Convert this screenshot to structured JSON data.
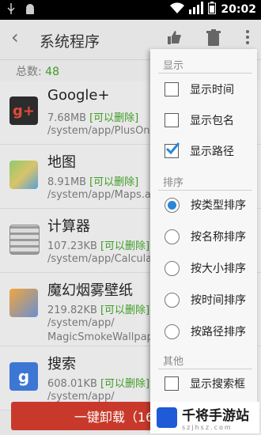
{
  "status": {
    "time": "20:02"
  },
  "toolbar": {
    "title": "系统程序"
  },
  "summary": {
    "label": "总数:",
    "count": "48"
  },
  "apps": [
    {
      "name": "Google+",
      "size": "7.68MB",
      "tag": "[可以删除]",
      "path": "/system/app/PlusOn"
    },
    {
      "name": "地图",
      "size": "8.91MB",
      "tag": "[可以删除]",
      "path": "/system/app/Maps.a"
    },
    {
      "name": "计算器",
      "size": "107.23KB",
      "tag": "[可以删除]",
      "path": "/system/app/Calcula"
    },
    {
      "name": "魔幻烟雾壁纸",
      "size": "219.82KB",
      "tag": "[可以删除]",
      "path": "/system/app/",
      "path2": "MagicSmokeWallpap"
    },
    {
      "name": "搜索",
      "size": "608.01KB",
      "tag": "[可以删除]",
      "path": "/system/app/"
    }
  ],
  "uninstall": {
    "label": "一键卸载（16"
  },
  "menu": {
    "display_header": "显示",
    "show_time": "显示时间",
    "show_package": "显示包名",
    "show_path": "显示路径",
    "sort_header": "排序",
    "sort_type": "按类型排序",
    "sort_name": "按名称排序",
    "sort_size": "按大小排序",
    "sort_time": "按时间排序",
    "sort_path": "按路径排序",
    "other_header": "其他",
    "show_search": "显示搜索框"
  },
  "watermark": {
    "name": "千将手游站",
    "domain": "szjhsz.com"
  },
  "colors": {
    "accent": "#3e9b26",
    "radio_on": "#2a86d6",
    "uninstall": "#c8392b"
  }
}
